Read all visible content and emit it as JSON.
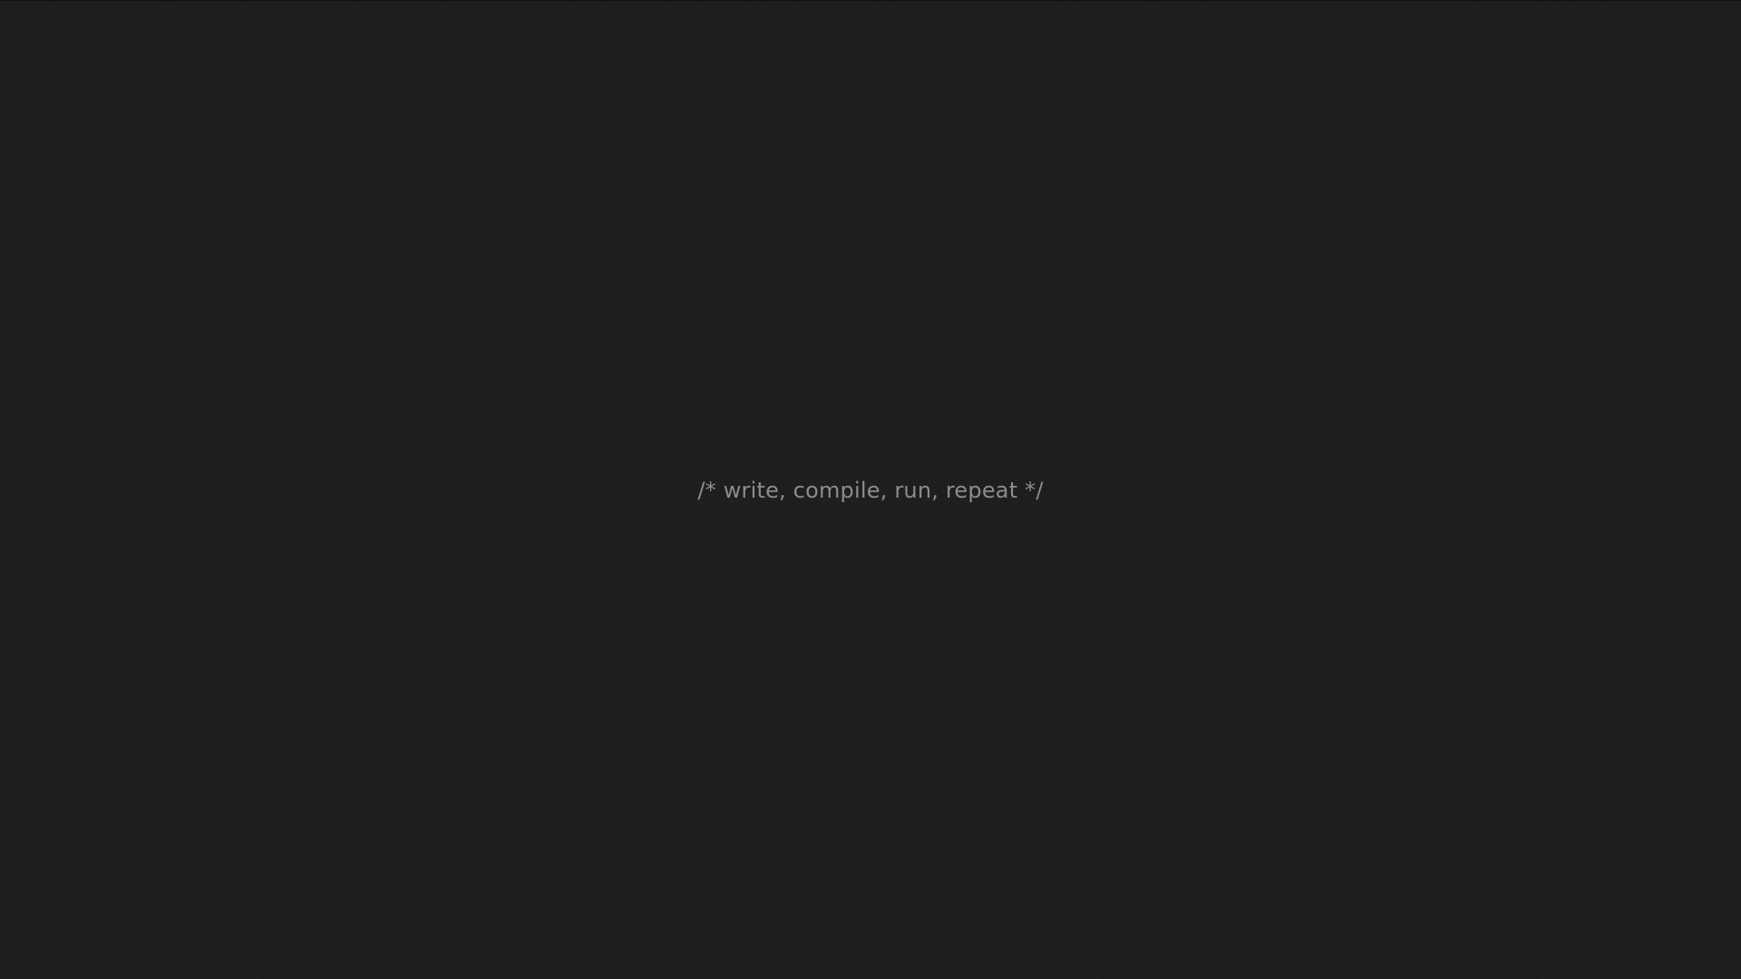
{
  "desktop": {
    "background_color": "#1e1e1e",
    "text_color": "#8c8c8c",
    "tagline": "/* write, compile, run, repeat */"
  }
}
